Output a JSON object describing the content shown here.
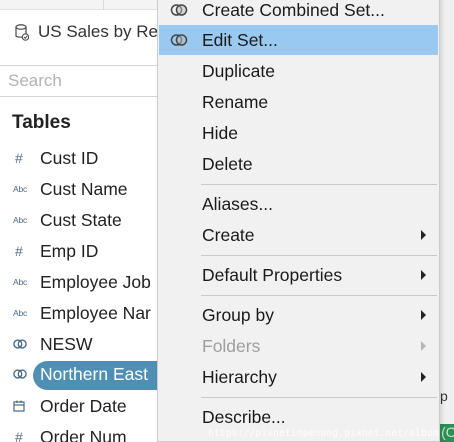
{
  "datasource": {
    "label": "US Sales by Re"
  },
  "search": {
    "placeholder": "Search"
  },
  "tables": {
    "heading": "Tables",
    "fields": [
      {
        "name": "Cust ID",
        "type": "number",
        "icon": "#"
      },
      {
        "name": "Cust Name",
        "type": "string",
        "icon": "Abc"
      },
      {
        "name": "Cust State",
        "type": "string",
        "icon": "Abc"
      },
      {
        "name": "Emp ID",
        "type": "number",
        "icon": "#"
      },
      {
        "name": "Employee Job",
        "type": "string",
        "icon": "Abc"
      },
      {
        "name": "Employee Nar",
        "type": "string",
        "icon": "Abc"
      },
      {
        "name": "NESW",
        "type": "set",
        "icon": "set-icon"
      },
      {
        "name": "Northern East",
        "type": "set",
        "icon": "set-icon",
        "selected": true
      },
      {
        "name": "Order Date",
        "type": "date",
        "icon": "calendar-icon"
      },
      {
        "name": "Order Num",
        "type": "number",
        "icon": "#"
      }
    ]
  },
  "context_menu": {
    "items": {
      "create_combined_set": "Create Combined Set...",
      "edit_set": "Edit Set...",
      "duplicate": "Duplicate",
      "rename": "Rename",
      "hide": "Hide",
      "delete": "Delete",
      "aliases": "Aliases...",
      "create": "Create",
      "default_properties": "Default Properties",
      "group_by": "Group by",
      "folders": "Folders",
      "hierarchy": "Hierarchy",
      "describe": "Describe..."
    }
  },
  "background": {
    "right_letter": "p",
    "green_text": "SUM(Ord"
  },
  "watermark": "https://pixnetinpenang.pixnet.net/album",
  "colors": {
    "highlight": "#99c9f0",
    "selected_pill": "#4f8fb4",
    "menu_bg": "#f1f1f1",
    "green": "#2e8f56"
  }
}
